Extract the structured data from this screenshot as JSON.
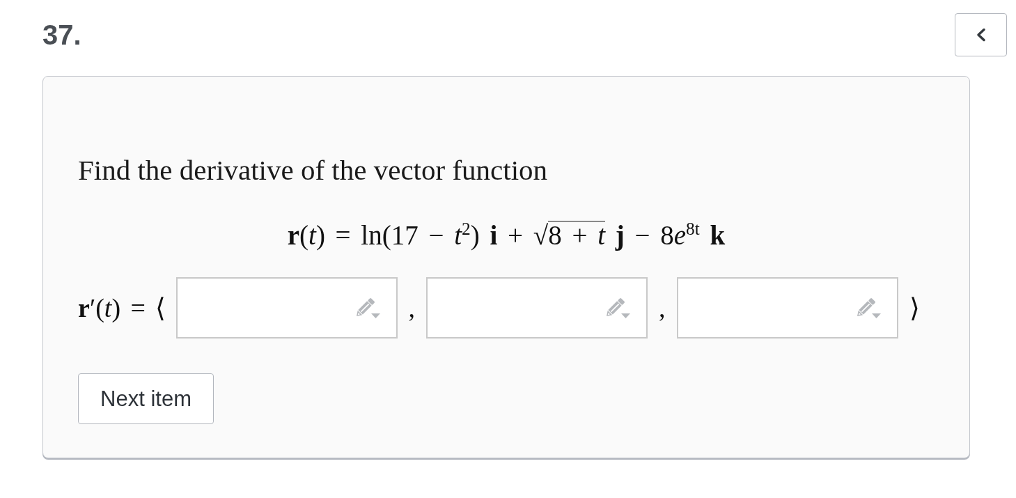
{
  "question": {
    "number": "37."
  },
  "card": {
    "prompt": "Find the derivative of the vector function",
    "formula": [
      {
        "kind": "text",
        "text": "**r**(*t*) = ln(17 − *t*$^{2}$) **i** + √"
      },
      {
        "kind": "sqrt",
        "text": "8 + *t*"
      },
      {
        "kind": "text",
        "text": " **j** − 8"
      },
      {
        "kind": "text",
        "text": "*e*$^{8t}$ **k**"
      }
    ],
    "answer": {
      "label": "**r**′(*t*) = ⟨",
      "items": [
        {
          "kind": "field"
        },
        {
          "kind": "separator",
          "text": ","
        },
        {
          "kind": "field"
        },
        {
          "kind": "separator",
          "text": ","
        },
        {
          "kind": "field"
        },
        {
          "kind": "separator",
          "text": "⟩"
        }
      ]
    },
    "next_button": "Next item"
  }
}
